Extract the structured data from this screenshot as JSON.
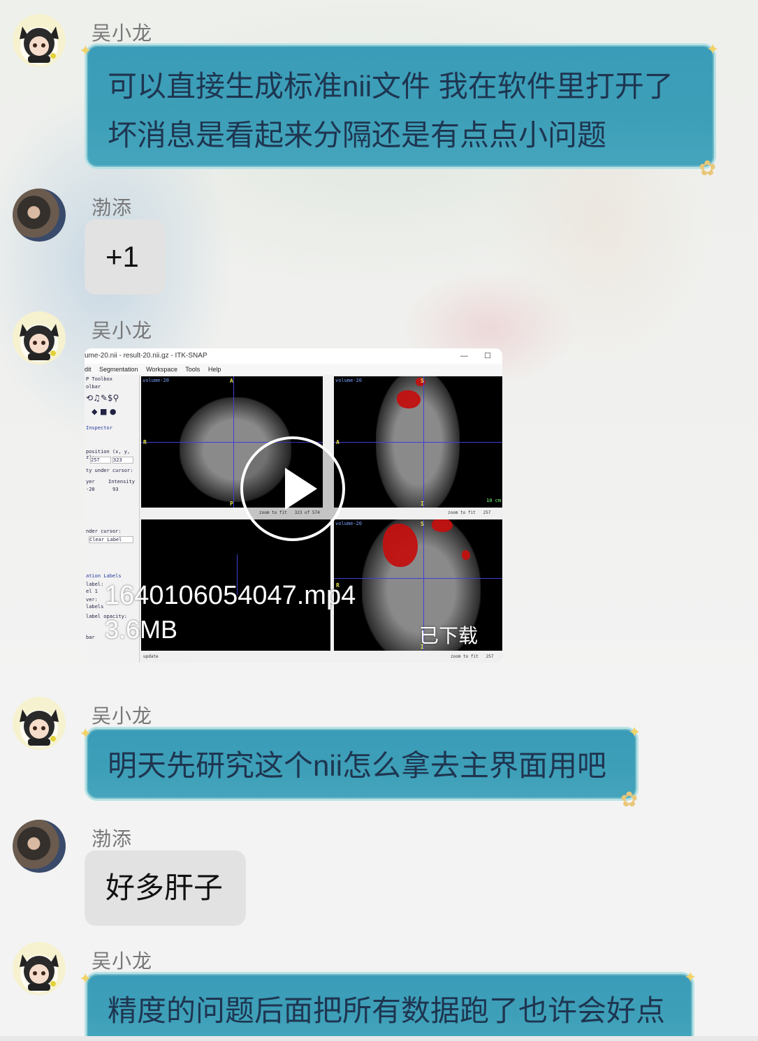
{
  "messages": [
    {
      "sender": "吴小龙",
      "type": "text",
      "lines": [
        "可以直接生成标准nii文件 我在软件里打开了",
        "坏消息是看起来分隔还是有点点小问题"
      ]
    },
    {
      "sender": "渤添",
      "type": "text",
      "lines": [
        "+1"
      ]
    },
    {
      "sender": "吴小龙",
      "type": "video",
      "file_name": "1640106054047.mp4",
      "file_size": "3.6MB",
      "status": "已下载",
      "preview": {
        "window_title": "ume-20.nii - result-20.nii.gz - ITK-SNAP",
        "window_controls": [
          "—",
          "☐"
        ],
        "menu": [
          "dit",
          "Segmentation",
          "Workspace",
          "Tools",
          "Help"
        ],
        "side_panel": [
          "P Toolbox",
          "olbar",
          "Inspector",
          "position (x, y, z):",
          "257",
          "323",
          "ty under cursor:",
          "yer",
          "Intensity",
          "-20",
          "93",
          "nder cursor:",
          "Clear Label",
          "ation Labels",
          "label:",
          "el 1",
          "ver:",
          "labels",
          "label opacity:",
          "bar"
        ],
        "pane_labels": [
          "volume-20",
          "volume-20",
          "volume-20"
        ],
        "axis_letters": {
          "axial": [
            "A",
            "R",
            "P"
          ],
          "sagittal": [
            "S",
            "A",
            "I"
          ],
          "coronal": [
            "S",
            "R",
            "I"
          ]
        },
        "footers": [
          "zoom to fit",
          "323 of 574",
          "zoom to fit",
          "257",
          "update",
          "zoom to fit",
          "257"
        ],
        "scale_label": "10 cm"
      }
    },
    {
      "sender": "吴小龙",
      "type": "text",
      "lines": [
        "明天先研究这个nii怎么拿去主界面用吧"
      ]
    },
    {
      "sender": "渤添",
      "type": "text",
      "lines": [
        "好多肝子"
      ]
    },
    {
      "sender": "吴小龙",
      "type": "text",
      "lines": [
        "精度的问题后面把所有数据跑了也许会好点"
      ]
    }
  ]
}
